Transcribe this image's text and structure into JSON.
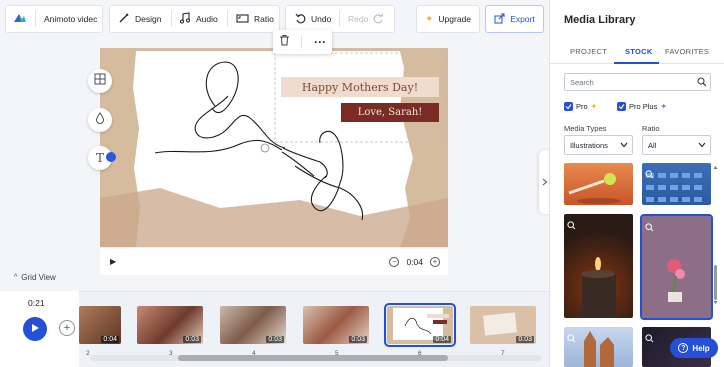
{
  "toolbar": {
    "project_name": "Animoto videc",
    "design_label": "Design",
    "audio_label": "Audio",
    "ratio_label": "Ratio",
    "undo_label": "Undo",
    "redo_label": "Redo",
    "upgrade_label": "Upgrade",
    "export_label": "Export"
  },
  "canvas": {
    "text_line_1": "Happy Mothers Day!",
    "text_line_2": "Love, Sarah!",
    "time": "0:04"
  },
  "grid_view_label": "Grid View",
  "timeline": {
    "current_time": "0:21",
    "scenes": [
      {
        "number": "2",
        "duration": "0:04"
      },
      {
        "number": "3",
        "duration": "0:03"
      },
      {
        "number": "4",
        "duration": "0:03"
      },
      {
        "number": "5",
        "duration": "0:03"
      },
      {
        "number": "6",
        "duration": "0:04"
      },
      {
        "number": "7",
        "duration": "0:03"
      }
    ]
  },
  "media_library": {
    "title": "Media Library",
    "tabs": [
      "PROJECT",
      "STOCK",
      "FAVORITES"
    ],
    "active_tab": "STOCK",
    "search_placeholder": "Search",
    "checkbox_pro": "Pro",
    "checkbox_pro_plus": "Pro Plus",
    "media_types_label": "Media Types",
    "media_types_value": "Illustrations",
    "ratio_label": "Ratio",
    "ratio_value": "All"
  },
  "help_label": "Help",
  "colors": {
    "accent": "#2350d6",
    "canvas_paper": "#d9c0a7",
    "text_highlight": "#7a2b25"
  }
}
